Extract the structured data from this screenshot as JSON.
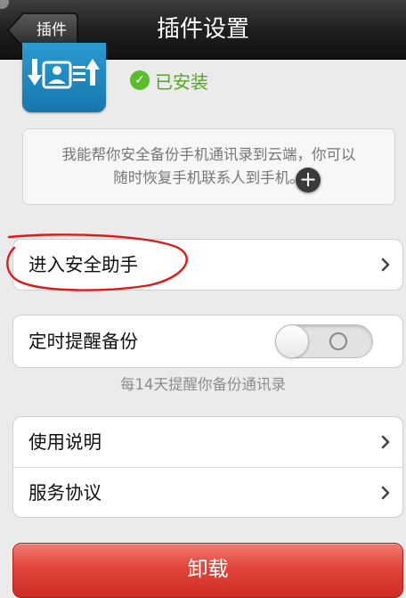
{
  "navbar": {
    "back_label": "插件",
    "title": "插件设置"
  },
  "plugin": {
    "icon": "contacts-backup-icon",
    "status_text": "已安装",
    "status_color": "#52a91f"
  },
  "description": {
    "line1": "我能帮你安全备份手机通讯录到云端，你可以",
    "line2": "随时恢复手机联系人到手机。",
    "overlay_icon": "plus-icon"
  },
  "cells": {
    "enter_assistant": "进入安全助手",
    "backup_reminder": "定时提醒备份",
    "backup_reminder_on": false,
    "usage_guide": "使用说明",
    "service_agreement": "服务协议"
  },
  "hint": "每14天提醒你备份通讯录",
  "uninstall_label": "卸载",
  "colors": {
    "navbar": "#1d1d1d",
    "uninstall": "#e0443a",
    "annotation": "#e01818"
  }
}
